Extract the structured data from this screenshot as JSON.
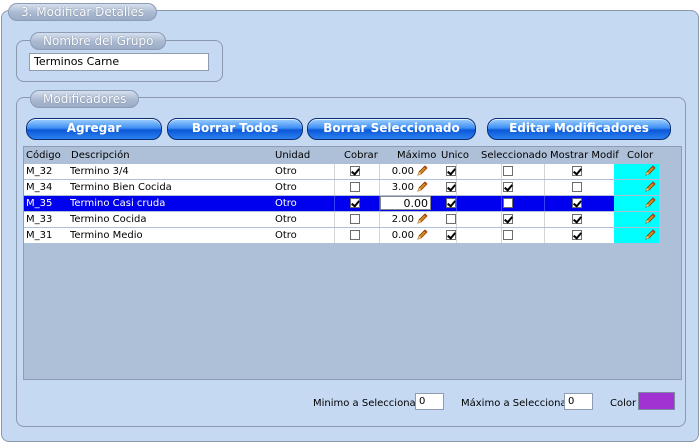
{
  "section_title": "3. Modificar Detalles",
  "group": {
    "legend": "Nombre del Grupo",
    "name_value": "Terminos Carne"
  },
  "modifiers": {
    "legend": "Modificadores",
    "buttons": {
      "add": "Agregar",
      "clear_all": "Borrar Todos",
      "clear_selected": "Borrar Seleccionado",
      "edit": "Editar Modificadores"
    },
    "columns": {
      "code": "Código",
      "description": "Descripción",
      "unit": "Unidad",
      "charge": "Cobrar",
      "max": "Máximo",
      "unique": "Unico",
      "selected": "Seleccionado",
      "show_modif": "Mostrar Modif",
      "color": "Color"
    },
    "rows": [
      {
        "code": "M_32",
        "description": "Termino 3/4",
        "unit": "Otro",
        "charge": true,
        "max": "0.00",
        "unique": true,
        "selected": false,
        "show": true,
        "color": "#00ffff",
        "is_selected_row": false
      },
      {
        "code": "M_34",
        "description": "Termino Bien Cocida",
        "unit": "Otro",
        "charge": false,
        "max": "3.00",
        "unique": true,
        "selected": true,
        "show": false,
        "color": "#00ffff",
        "is_selected_row": false
      },
      {
        "code": "M_35",
        "description": "Termino Casi cruda",
        "unit": "Otro",
        "charge": true,
        "max": "0.00",
        "unique": true,
        "selected": false,
        "show": true,
        "color": "#00ffff",
        "is_selected_row": true
      },
      {
        "code": "M_33",
        "description": "Termino Cocida",
        "unit": "Otro",
        "charge": false,
        "max": "2.00",
        "unique": false,
        "selected": true,
        "show": true,
        "color": "#00ffff",
        "is_selected_row": false
      },
      {
        "code": "M_31",
        "description": "Termino Medio",
        "unit": "Otro",
        "charge": false,
        "max": "0.00",
        "unique": true,
        "selected": false,
        "show": true,
        "color": "#00ffff",
        "is_selected_row": false
      }
    ],
    "footer": {
      "min_label": "Minimo a Seleccionar",
      "min_value": "0",
      "max_label": "Máximo a Seleccionar",
      "max_value": "0",
      "color_label": "Color",
      "color_value": "#a033d2"
    },
    "icons": {
      "edit": "pencil-icon"
    },
    "colors": {
      "selection": "#0000ee",
      "cell_color": "#00ffff",
      "button": "#1f6fe6"
    }
  }
}
